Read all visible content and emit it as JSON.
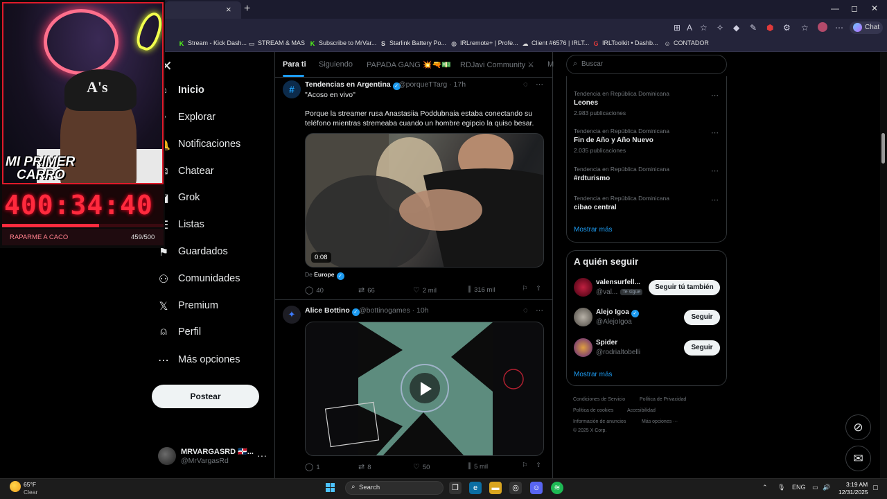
{
  "browser": {
    "new_tab": "+",
    "close_tab": "×",
    "window_controls": [
      "—",
      "◻",
      "✕"
    ],
    "chat_label": "Chat",
    "bookmarks": [
      {
        "label": "Stream - Kick Dash...",
        "icon": "K",
        "color": "#53fc18"
      },
      {
        "label": "STREAM & MAS",
        "icon": "▭",
        "color": "#e0e0e0"
      },
      {
        "label": "Subscribe to MrVar...",
        "icon": "K",
        "color": "#53fc18"
      },
      {
        "label": "Starlink Battery Po...",
        "icon": "S",
        "color": "#e0e0e0"
      },
      {
        "label": "IRLremote+ | Profe...",
        "icon": "◍",
        "color": "#e0e0e0"
      },
      {
        "label": "Client #6576 | IRLT...",
        "icon": "☁",
        "color": "#e0e0e0"
      },
      {
        "label": "IRLToolkit • Dashb...",
        "icon": "G",
        "color": "#e03a3a"
      },
      {
        "label": "CONTADOR",
        "icon": "☺",
        "color": "#e0e0e0"
      }
    ]
  },
  "overlay": {
    "promo_line1": "MI PRIMER",
    "promo_line2": "CARRO",
    "timer": "400:34:40",
    "goal_label": "RAPARME A CACO",
    "goal_count": "459/500",
    "goal_progress": 0.6,
    "cap_logo": "A's"
  },
  "nav": {
    "items": [
      {
        "label": "Inicio",
        "icon": "⌂"
      },
      {
        "label": "Explorar",
        "icon": "⌕"
      },
      {
        "label": "Notificaciones",
        "icon": "🔔"
      },
      {
        "label": "Chatear",
        "icon": "✉"
      },
      {
        "label": "Grok",
        "icon": "◪"
      },
      {
        "label": "Listas",
        "icon": "☰"
      },
      {
        "label": "Guardados",
        "icon": "⚑"
      },
      {
        "label": "Comunidades",
        "icon": "⚇"
      },
      {
        "label": "Premium",
        "icon": "𝕏"
      },
      {
        "label": "Perfil",
        "icon": "⍝"
      },
      {
        "label": "Más opciones",
        "icon": "⋯"
      }
    ],
    "post_button": "Postear",
    "account_name": "MRVARGASRD 🇩🇴...",
    "account_handle": "@MrVargasRd",
    "account_more": "···"
  },
  "feed": {
    "tabs": [
      "Para ti",
      "Siguiendo",
      "PAPADA GANG 💥🔫💵",
      "RDJavi Community ⚔",
      "M"
    ],
    "posts": [
      {
        "author": "Tendencias en Argentina",
        "handle": "@porqueTTarg · 17h",
        "subtitle": "\"Acoso en vivo\"",
        "text": "Porque la streamer rusa Anastasiia Poddubnaia estaba conectando su teléfono mientras stremeaba cuando un hombre egipcio la quiso besar.",
        "video_duration": "0:08",
        "attribution_prefix": "De",
        "attribution_source": "Europe",
        "replies": "40",
        "reposts": "66",
        "likes": "2 mil",
        "views": "316 mil"
      },
      {
        "author": "Alice Bottino",
        "handle": "@bottinogames · 10h",
        "replies": "1",
        "reposts": "8",
        "likes": "50",
        "views": "5 mil"
      }
    ]
  },
  "search": {
    "placeholder": "Buscar"
  },
  "trends": {
    "items": [
      {
        "context": "Tendencia en República Dominicana",
        "name": "Leones",
        "count": "2.983 publicaciones"
      },
      {
        "context": "Tendencia en República Dominicana",
        "name": "Fin de Año y Año Nuevo",
        "count": "2.035 publicaciones"
      },
      {
        "context": "Tendencia en República Dominicana",
        "name": "#rdturismo",
        "count": ""
      },
      {
        "context": "Tendencia en República Dominicana",
        "name": "cibao central",
        "count": ""
      }
    ],
    "show_more": "Mostrar más"
  },
  "who_to_follow": {
    "title": "A quién seguir",
    "users": [
      {
        "name": "valensurfell...",
        "handle": "@val...",
        "badge": "Te sigue",
        "button": "Seguir tú también"
      },
      {
        "name": "Alejo Igoa",
        "handle": "@AlejoIgoa",
        "button": "Seguir"
      },
      {
        "name": "Spider",
        "handle": "@rodrialtobelli",
        "button": "Seguir"
      }
    ],
    "show_more": "Mostrar más"
  },
  "footer": {
    "links": [
      "Condiciones de Servicio",
      "Política de Privacidad",
      "Política de cookies",
      "Accesibilidad",
      "Información de anuncios",
      "Más opciones ···"
    ],
    "copyright": "© 2025 X Corp."
  },
  "taskbar": {
    "weather_temp": "65°F",
    "weather_desc": "Clear",
    "search_label": "Search",
    "language": "ENG",
    "time": "3:19 AM",
    "date": "12/31/2025"
  }
}
